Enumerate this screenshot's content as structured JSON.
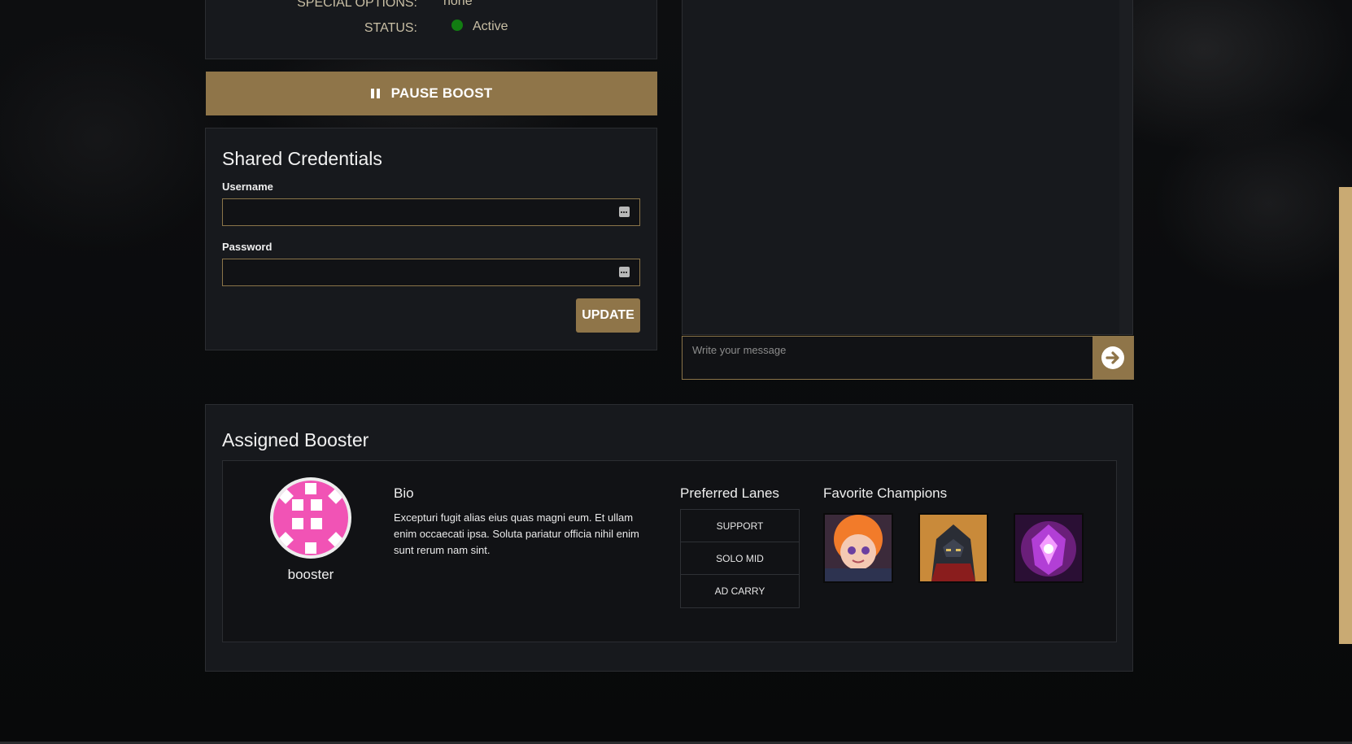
{
  "status_panel": {
    "special_options_label": "SPECIAL OPTIONS:",
    "special_options_value": "none",
    "status_label": "STATUS:",
    "status_value": "Active"
  },
  "pause_button": {
    "label": "PAUSE BOOST"
  },
  "credentials": {
    "title": "Shared Credentials",
    "username_label": "Username",
    "password_label": "Password",
    "update_label": "UPDATE"
  },
  "chat": {
    "placeholder": "Write your message"
  },
  "booster": {
    "section_title": "Assigned Booster",
    "name": "booster",
    "bio_title": "Bio",
    "bio_text": "Excepturi fugit alias eius quas magni eum. Et ullam enim occaecati ipsa. Soluta pariatur officia nihil enim sunt rerum nam sint.",
    "lanes_title": "Preferred Lanes",
    "lanes": [
      "SUPPORT",
      "SOLO MID",
      "AD CARRY"
    ],
    "champions_title": "Favorite Champions"
  },
  "colors": {
    "accent": "#8f7549",
    "status_active": "#127d12",
    "avatar_pink": "#f153b5"
  }
}
